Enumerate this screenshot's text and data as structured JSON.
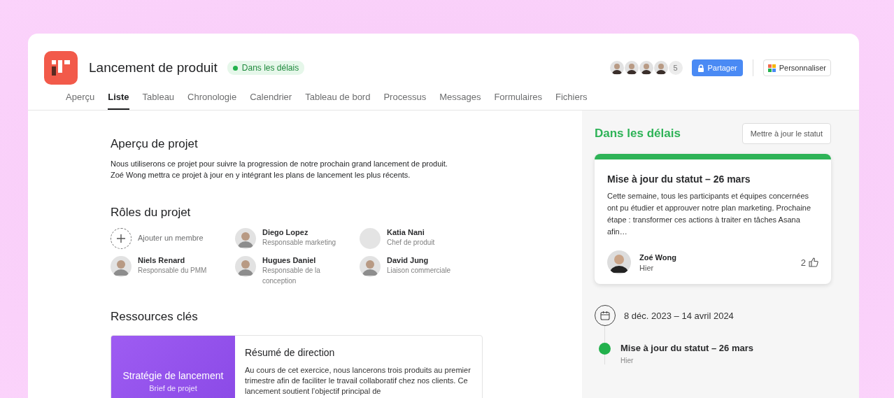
{
  "project": {
    "title": "Lancement de produit",
    "status": "Dans les délais",
    "members_more": "5",
    "members": [
      {
        "kind": "photo"
      },
      {
        "kind": "photo"
      },
      {
        "kind": "photo"
      },
      {
        "kind": "photo"
      }
    ],
    "share_button": "Partager",
    "customize_button": "Personnaliser"
  },
  "tabs": [
    {
      "label": "Aperçu",
      "selected": false
    },
    {
      "label": "Liste",
      "selected": true
    },
    {
      "label": "Tableau",
      "selected": false
    },
    {
      "label": "Chronologie",
      "selected": false
    },
    {
      "label": "Calendrier",
      "selected": false
    },
    {
      "label": "Tableau de bord",
      "selected": false
    },
    {
      "label": "Processus",
      "selected": false
    },
    {
      "label": "Messages",
      "selected": false
    },
    {
      "label": "Formulaires",
      "selected": false
    },
    {
      "label": "Fichiers",
      "selected": false
    }
  ],
  "overview": {
    "title": "Aperçu de projet",
    "text": "Nous utiliserons ce projet pour suivre la progression de notre prochain grand lancement de produit.\nZoé Wong mettra ce projet à jour en y intégrant les plans de lancement les plus récents."
  },
  "roles": {
    "title": "Rôles du projet",
    "members": [
      {
        "kind": "add",
        "name": "Ajouter un membre"
      },
      {
        "kind": "person",
        "name": "Diego Lopez",
        "role": "Responsable marketing"
      },
      {
        "kind": "empty",
        "name": "Katia Nani",
        "role": "Chef de produit"
      },
      {
        "kind": "person",
        "name": "Niels Renard",
        "role": "Responsable du PMM"
      },
      {
        "kind": "person",
        "name": "Hugues Daniel",
        "role": "Responsable de la conception"
      },
      {
        "kind": "person",
        "name": "David Jung",
        "role": "Liaison commerciale"
      }
    ]
  },
  "resources": {
    "title": "Ressources clés",
    "cards": [
      {
        "cover_title": "Stratégie de lancement",
        "cover_subtitle": "Brief de projet",
        "title": "Résumé de direction",
        "text": "Au cours de cet exercice, nous lancerons trois produits au premier trimestre afin de faciliter le travail collaboratif chez nos clients. Ce lancement soutient l’objectif principal de"
      }
    ]
  },
  "status_panel": {
    "heading": "Dans les délais",
    "update_button": "Mettre à jour le statut",
    "update": {
      "title": "Mise à jour du statut – 26 mars",
      "text": "Cette semaine, tous les participants et équipes concernées ont pu étudier et approuver notre plan marketing. Prochaine étape : transformer ces actions à traiter en tâches Asana afin…",
      "author": "Zoé Wong",
      "time": "Hier",
      "likes": "2"
    },
    "timeline": {
      "dates": "8 déc. 2023 – 14 avril 2024",
      "events": [
        {
          "title": "Mise à jour du statut – 26 mars",
          "time": "Hier",
          "color": "#22b14c"
        }
      ]
    }
  }
}
